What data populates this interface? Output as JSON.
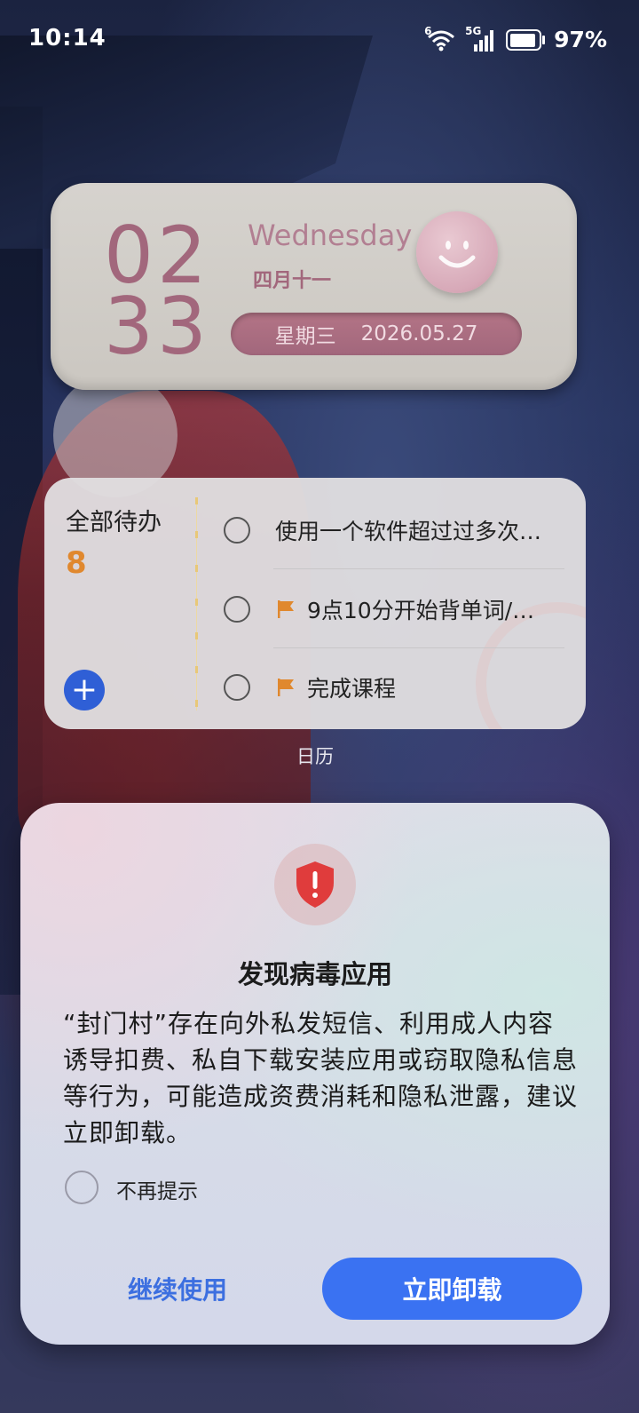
{
  "status_bar": {
    "time": "10:14",
    "wifi_badge": "6",
    "network": "5G",
    "battery_percent": "97%",
    "battery_level": 0.97
  },
  "clock_widget": {
    "hour": "02",
    "minute": "33",
    "weekday_en": "Wednesday",
    "lunar_date": "四月十一",
    "weekday_cn": "星期三",
    "date": "2026.05.27",
    "accent_color": "#a2677c"
  },
  "todo_widget": {
    "title": "全部待办",
    "count": "8",
    "count_color": "#e0882e",
    "items": [
      {
        "text": "使用一个软件超过过多次…",
        "flagged": false
      },
      {
        "text": "9点10分开始背单词/…",
        "flagged": true
      },
      {
        "text": "完成课程",
        "flagged": true
      }
    ],
    "flag_color": "#e0882e"
  },
  "calendar_label": "日历",
  "dialog": {
    "title": "发现病毒应用",
    "body": "“封门村”存在向外私发短信、利用成人内容诱导扣费、私自下载安装应用或窃取隐私信息等行为，可能造成资费消耗和隐私泄露，建议立即卸载。",
    "dont_remind_label": "不再提示",
    "continue_label": "继续使用",
    "uninstall_label": "立即卸载",
    "shield_color": "#e03c3c",
    "primary_color": "#3a72f2"
  }
}
